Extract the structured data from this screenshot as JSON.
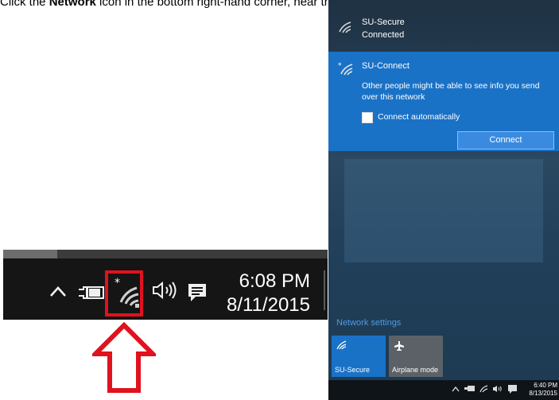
{
  "instruction": {
    "prefix": "Click the ",
    "bold": "Network",
    "suffix": " icon in the bottom right-hand corner, near the date and time."
  },
  "taskbar": {
    "time": "6:08 PM",
    "date": "8/11/2015",
    "icons": [
      "chevron-up-icon",
      "power-plug-icon",
      "wifi-icon",
      "volume-icon",
      "action-center-icon"
    ]
  },
  "highlight": {
    "color": "#e0121d"
  },
  "flyout": {
    "networks": [
      {
        "name": "SU-Secure",
        "status": "Connected"
      },
      {
        "name": "SU-Connect",
        "warning": "Other people might be able to see info you send over this network",
        "auto_connect_label": "Connect automatically",
        "auto_connect_checked": false,
        "connect_label": "Connect"
      }
    ],
    "network_settings_label": "Network settings",
    "tiles": [
      {
        "label": "SU-Secure",
        "icon": "wifi-icon",
        "active": true
      },
      {
        "label": "Airplane mode",
        "icon": "airplane-icon",
        "active": false
      }
    ],
    "mini_taskbar": {
      "time": "6:40 PM",
      "date": "8/13/2015"
    },
    "accent": "#1a72c7"
  }
}
